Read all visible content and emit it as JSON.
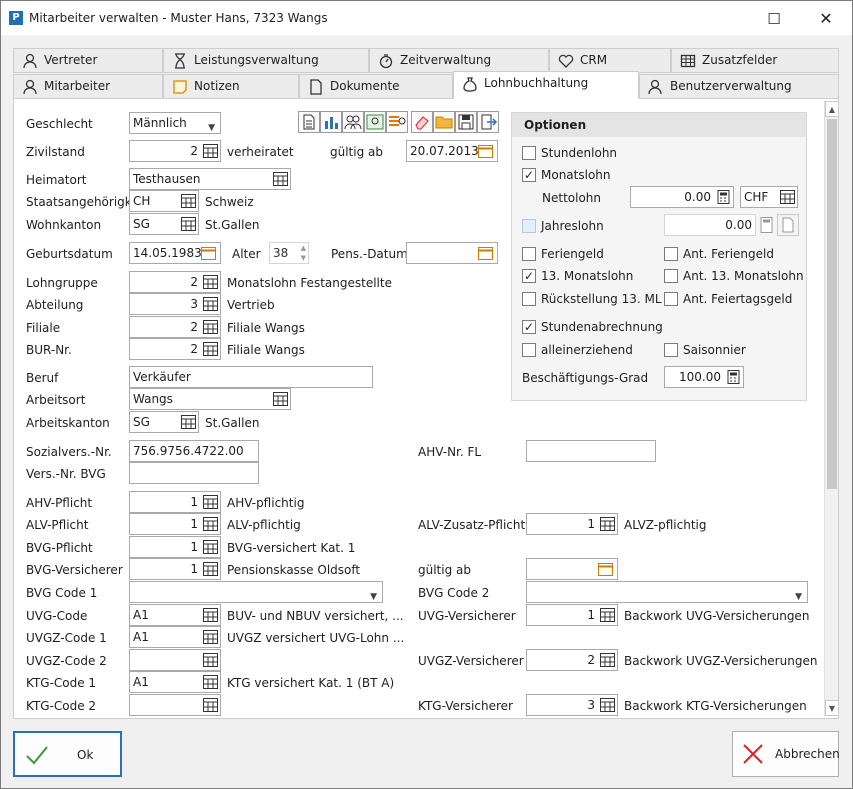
{
  "window": {
    "title": "Mitarbeiter verwalten - Muster Hans, 7323 Wangs",
    "minimize": "☐",
    "close": "✕"
  },
  "tabs_row1": [
    "Vertreter",
    "Leistungsverwaltung",
    "Zeitverwaltung",
    "CRM",
    "Zusatzfelder"
  ],
  "tabs_row2": [
    "Mitarbeiter",
    "Notizen",
    "Dokumente",
    "Lohnbuchhaltung",
    "Benutzerverwaltung"
  ],
  "form": {
    "geschlecht": {
      "label": "Geschlecht",
      "value": "Männlich"
    },
    "zivilstand": {
      "label": "Zivilstand",
      "value": "2",
      "text": "verheiratet",
      "gueltig_label": "gültig ab",
      "gueltig_value": "20.07.2013"
    },
    "heimatort": {
      "label": "Heimatort",
      "value": "Testhausen"
    },
    "staatsangehoerigk": {
      "label": "Staatsangehörigk.",
      "value": "CH",
      "text": "Schweiz"
    },
    "wohnkanton": {
      "label": "Wohnkanton",
      "value": "SG",
      "text": "St.Gallen"
    },
    "geburtsdatum": {
      "label": "Geburtsdatum",
      "value": "14.05.1983",
      "alter_label": "Alter",
      "alter_value": "38",
      "pens_label": "Pens.-Datum",
      "pens_value": ""
    },
    "lohngruppe": {
      "label": "Lohngruppe",
      "value": "2",
      "text": "Monatslohn Festangestellte"
    },
    "abteilung": {
      "label": "Abteilung",
      "value": "3",
      "text": "Vertrieb"
    },
    "filiale": {
      "label": "Filiale",
      "value": "2",
      "text": "Filiale Wangs"
    },
    "bur": {
      "label": "BUR-Nr.",
      "value": "2",
      "text": "Filiale Wangs"
    },
    "beruf": {
      "label": "Beruf",
      "value": "Verkäufer"
    },
    "arbeitsort": {
      "label": "Arbeitsort",
      "value": "Wangs"
    },
    "arbeitskanton": {
      "label": "Arbeitskanton",
      "value": "SG",
      "text": "St.Gallen"
    },
    "sozialvers": {
      "label": "Sozialvers.-Nr.",
      "value": "756.9756.4722.00"
    },
    "ahv_fl": {
      "label": "AHV-Nr. FL",
      "value": ""
    },
    "vers_bvg": {
      "label": "Vers.-Nr. BVG",
      "value": ""
    },
    "ahv_pflicht": {
      "label": "AHV-Pflicht",
      "value": "1",
      "text": "AHV-pflichtig"
    },
    "alv_pflicht": {
      "label": "ALV-Pflicht",
      "value": "1",
      "text": "ALV-pflichtig"
    },
    "alv_zusatz": {
      "label": "ALV-Zusatz-Pflicht",
      "value": "1",
      "text": "ALVZ-pflichtig"
    },
    "bvg_pflicht": {
      "label": "BVG-Pflicht",
      "value": "1",
      "text": "BVG-versichert Kat. 1"
    },
    "bvg_versicherer": {
      "label": "BVG-Versicherer",
      "value": "1",
      "text": "Pensionskasse Oldsoft",
      "gueltig_label": "gültig ab",
      "gueltig_value": ""
    },
    "bvg_code1": {
      "label": "BVG Code 1",
      "value": ""
    },
    "bvg_code2": {
      "label": "BVG Code 2",
      "value": ""
    },
    "uvg_code": {
      "label": "UVG-Code",
      "value": "A1",
      "text": "BUV- und NBUV versichert, ..."
    },
    "uvg_versicherer": {
      "label": "UVG-Versicherer",
      "value": "1",
      "text": "Backwork UVG-Versicherungen"
    },
    "uvgz_code1": {
      "label": "UVGZ-Code 1",
      "value": "A1",
      "text": "UVGZ versichert UVG-Lohn ..."
    },
    "uvgz_code2": {
      "label": "UVGZ-Code 2",
      "value": ""
    },
    "uvgz_versicherer": {
      "label": "UVGZ-Versicherer",
      "value": "2",
      "text": "Backwork UVGZ-Versicherungen"
    },
    "ktg_code1": {
      "label": "KTG-Code 1",
      "value": "A1",
      "text": "KTG versichert Kat. 1 (BT A)"
    },
    "ktg_code2": {
      "label": "KTG-Code 2",
      "value": ""
    },
    "ktg_versicherer": {
      "label": "KTG-Versicherer",
      "value": "3",
      "text": "Backwork KTG-Versicherungen"
    }
  },
  "optionen": {
    "title": "Optionen",
    "stundenlohn": "Stundenlohn",
    "monatslohn": "Monatslohn",
    "nettolohn_label": "Nettolohn",
    "nettolohn_value": "0.00",
    "currency": "CHF",
    "jahreslohn": "Jahreslohn",
    "jahreslohn_value": "0.00",
    "feriengeld": "Feriengeld",
    "ant_feriengeld": "Ant. Feriengeld",
    "monatslohn13": "13. Monatslohn",
    "ant_monatslohn13": "Ant. 13. Monatslohn",
    "rueckstellung": "Rückstellung 13. ML",
    "ant_feiertagsgeld": "Ant. Feiertagsgeld",
    "stundenabrechnung": "Stundenabrechnung",
    "alleinerziehend": "alleinerziehend",
    "saisonnier": "Saisonnier",
    "beschaeftigung_label": "Beschäftigungs-Grad",
    "beschaeftigung_value": "100.00",
    "check": "✓"
  },
  "buttons": {
    "ok": "Ok",
    "cancel": "Abbrechen"
  }
}
